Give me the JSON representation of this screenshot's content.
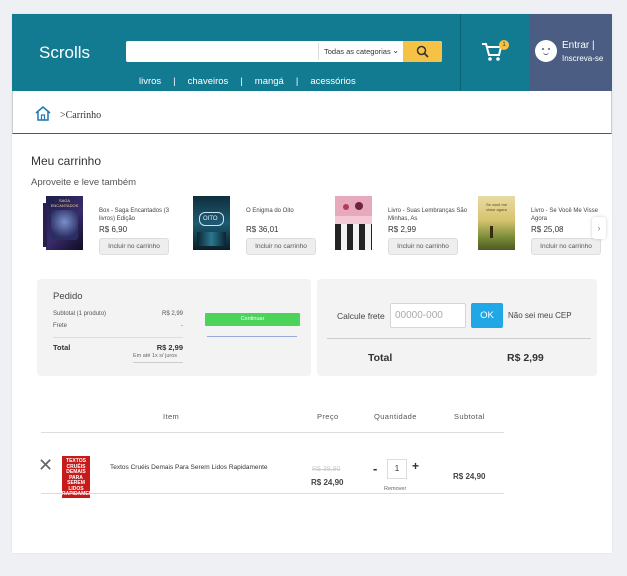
{
  "header": {
    "logo": "Scrolls",
    "search": {
      "placeholder": "",
      "category": "Todas as categorias"
    },
    "nav": [
      "livros",
      "chaveiros",
      "mangá",
      "acessórios"
    ],
    "cart_count": "1",
    "login": {
      "line1": "Entrar |",
      "line2": "Inscreva-se"
    },
    "colors": {
      "header_bg": "#127b92",
      "accent": "#f6c245",
      "login_bg": "#4b5d82"
    }
  },
  "breadcrumb": {
    "text": ">Carrinho"
  },
  "main": {
    "title": "Meu carrinho",
    "suggest_title": "Aproveite e leve também"
  },
  "suggestions": [
    {
      "name": "Box - Saga Encantados (3 livros) Edição",
      "price": "R$ 6,90",
      "button": "Incluir no carrinho"
    },
    {
      "name": "O Enigma do Oito",
      "price": "R$ 36,01",
      "button": "Incluir no carrinho"
    },
    {
      "name": "Livro - Suas Lembranças São Minhas, As",
      "price": "R$ 2,99",
      "button": "Incluir no carrinho"
    },
    {
      "name": "Livro - Se Você Me Visse Agora",
      "price": "R$ 25,08",
      "button": "Incluir no carrinho"
    }
  ],
  "order": {
    "title": "Pedido",
    "subtotal_label": "Subtotal (1 produto)",
    "subtotal_value": "R$ 2,99",
    "shipping_label": "Frete",
    "shipping_value": "-",
    "total_label": "Total",
    "total_value": "R$ 2,99",
    "installments": "Em até 1x s/ juros",
    "continue_label": "Continuar"
  },
  "shipping": {
    "label": "Calcule frete",
    "placeholder": "00000-000",
    "ok_label": "OK",
    "no_cep": "Não sei meu CEP",
    "total_label": "Total",
    "total_value": "R$ 2,99"
  },
  "table": {
    "headers": {
      "item": "Item",
      "price": "Preço",
      "qty": "Quantidade",
      "subtotal": "Subtotal"
    },
    "rows": [
      {
        "cover_text": "TEXTOS CRUÉIS DEMAIS PARA SEREM LIDOS RAPIDAMENTE",
        "title": "Textos Cruéis Demais Para Serem Lidos Rapidamente",
        "old_price": "R$ 39,90",
        "price": "R$ 24,90",
        "qty": "1",
        "remove": "Remover",
        "subtotal": "R$ 24,90"
      }
    ]
  }
}
